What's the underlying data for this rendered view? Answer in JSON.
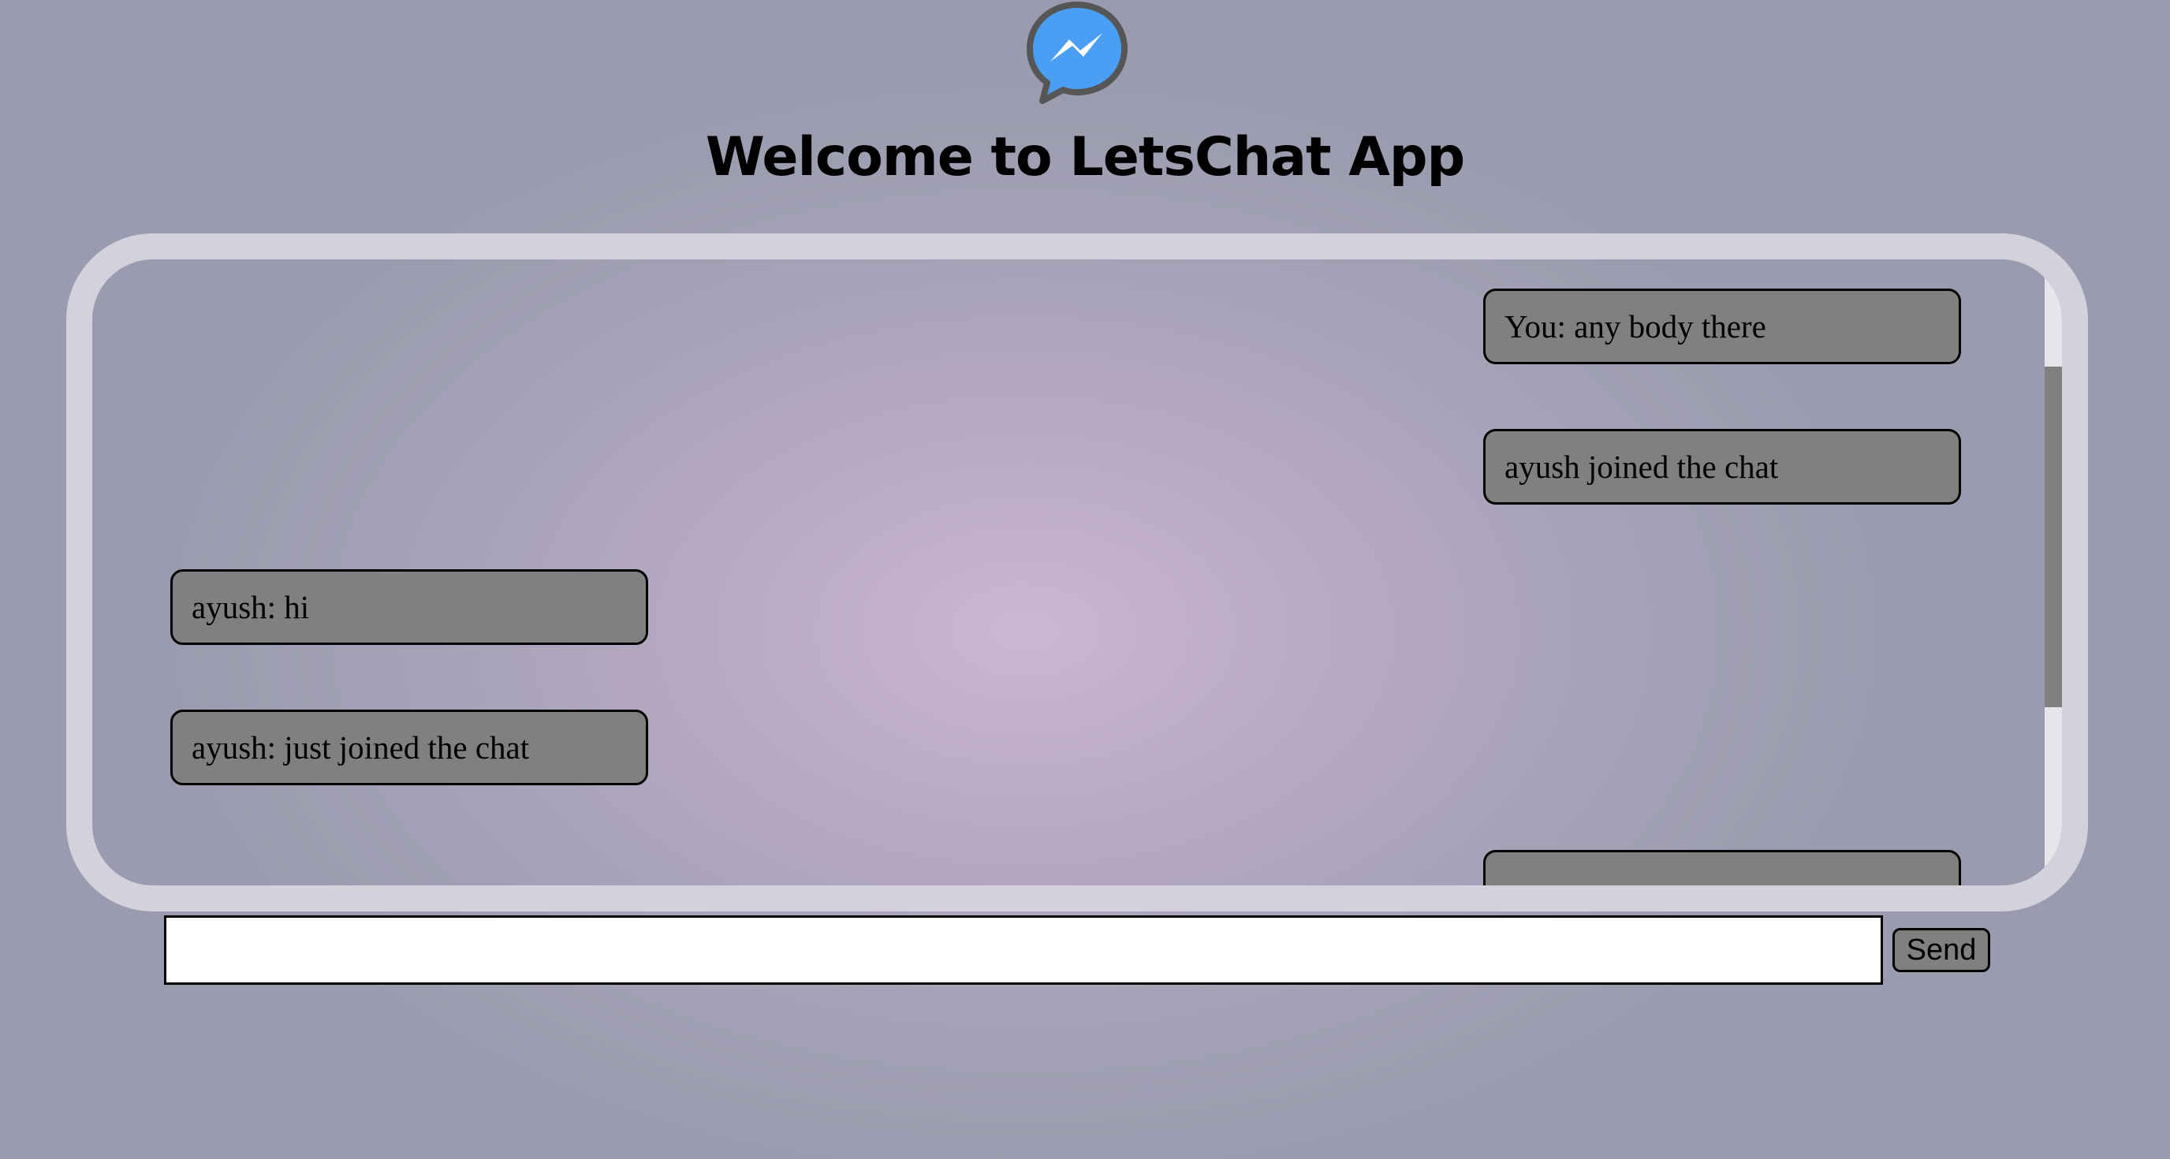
{
  "app": {
    "title": "Welcome to LetsChat App",
    "logo_icon": "messenger-icon"
  },
  "messages": [
    {
      "text": "You: any body there",
      "side": "right"
    },
    {
      "text": "ayush joined the chat",
      "side": "right"
    },
    {
      "text": "ayush: hi",
      "side": "left"
    },
    {
      "text": "ayush: just joined the chat",
      "side": "left"
    },
    {
      "text": "",
      "side": "right"
    }
  ],
  "composer": {
    "input_value": "",
    "input_placeholder": "",
    "send_label": "Send"
  },
  "colors": {
    "background": "#9a9bae",
    "frame": "#d2d1dc",
    "bubble": "#808080",
    "logo_blue": "#4a9ff5"
  }
}
